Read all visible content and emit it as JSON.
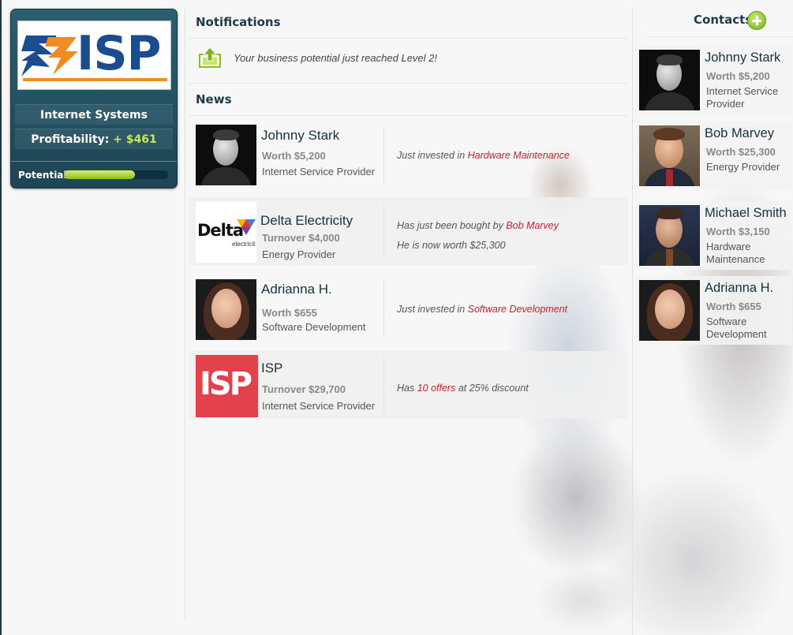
{
  "company": {
    "logo_text": "ISP",
    "name": "Internet Systems",
    "profitability_label": "Profitability:",
    "profitability_value": "+ $461",
    "potential_label": "Potential",
    "potential_level": 0.68
  },
  "notifications": {
    "title": "Notifications",
    "items": [
      {
        "icon": "upload-icon",
        "text": "Your business potential just reached Level 2!"
      }
    ]
  },
  "news": {
    "title": "News",
    "items": [
      {
        "name": "Johnny Stark",
        "stat": "Worth $5,200",
        "role": "Internet Service Provider",
        "lines": [
          {
            "prefix": "Just invested in ",
            "highlight": "Hardware Maintenance",
            "suffix": ""
          }
        ]
      },
      {
        "name": "Delta Electricity",
        "stat": "Turnover $4,000",
        "role": "Energy Provider",
        "logo_text": "Delta",
        "logo_sub": "electricit",
        "lines": [
          {
            "prefix": "Has just been bought by ",
            "highlight": "Bob Marvey",
            "suffix": ""
          },
          {
            "prefix": "He is now worth $25,300",
            "highlight": "",
            "suffix": ""
          }
        ]
      },
      {
        "name": "Adrianna H.",
        "stat": "Worth $655",
        "role": "Software Development",
        "lines": [
          {
            "prefix": "Just invested in ",
            "highlight": "Software Development",
            "suffix": ""
          }
        ]
      },
      {
        "name": "ISP",
        "stat": "Turnover $29,700",
        "role": "Internet Service Provider",
        "logo_text": "ISP",
        "lines": [
          {
            "prefix": "Has ",
            "highlight": "10 offers",
            "suffix": " at 25% discount"
          }
        ]
      }
    ]
  },
  "contacts": {
    "title": "Contacts",
    "items": [
      {
        "name": "Johnny Stark",
        "worth": "Worth $5,200",
        "role": "Internet Service Provider"
      },
      {
        "name": "Bob Marvey",
        "worth": "Worth $25,300",
        "role": "Energy Provider"
      },
      {
        "name": "Michael Smith",
        "worth": "Worth $3,150",
        "role": "Hardware Maintenance"
      },
      {
        "name": "Adrianna H.",
        "worth": "Worth $655",
        "role": "Software Development"
      }
    ]
  },
  "colors": {
    "panel": "#1d4555",
    "accent_green": "#8ebd1d",
    "highlight_red": "#c8242c",
    "heading": "#1e3a48"
  }
}
